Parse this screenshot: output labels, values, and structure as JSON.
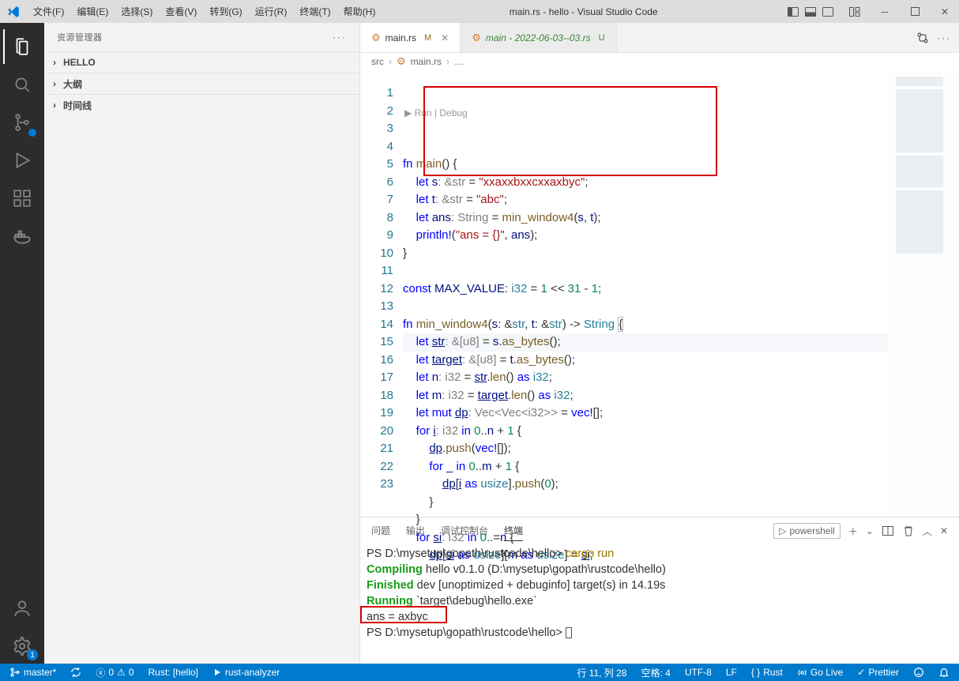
{
  "title": "main.rs - hello - Visual Studio Code",
  "menu": [
    "文件(F)",
    "编辑(E)",
    "选择(S)",
    "查看(V)",
    "转到(G)",
    "运行(R)",
    "终端(T)",
    "帮助(H)"
  ],
  "sidebar": {
    "header": "资源管理器",
    "sections": [
      {
        "label": "HELLO",
        "expanded": false
      },
      {
        "label": "大纲",
        "expanded": false
      },
      {
        "label": "时间线",
        "expanded": false
      }
    ]
  },
  "tabs": [
    {
      "icon": "rust",
      "label": "main.rs",
      "status": "M",
      "active": true,
      "closable": true
    },
    {
      "icon": "rust",
      "label": "main - 2022-06-03--03.rs",
      "status": "U",
      "active": false,
      "style": "italic"
    }
  ],
  "breadcrumb": {
    "parts": [
      "src",
      "main.rs",
      "…"
    ],
    "icon_after_src": "rust"
  },
  "codelens": "▶ Run | Debug",
  "code_lines": [
    {
      "n": 1,
      "html": "<span class='kw'>fn</span> <span class='fnname'>main</span>() {"
    },
    {
      "n": 2,
      "html": "    <span class='kw'>let</span> <span class='varsimple'>s</span><span class='fade'>: &str</span> = <span class='str'>\"xxaxxbxxcxxaxbyc\"</span>;"
    },
    {
      "n": 3,
      "html": "    <span class='kw'>let</span> <span class='varsimple'>t</span><span class='fade'>: &str</span> = <span class='str'>\"abc\"</span>;"
    },
    {
      "n": 4,
      "html": "    <span class='kw'>let</span> <span class='varsimple'>ans</span><span class='fade'>: String</span> = <span class='fnname'>min_window4</span>(<span class='varsimple'>s</span>, <span class='varsimple'>t</span>);"
    },
    {
      "n": 5,
      "html": "    <span class='macro'>println!</span>(<span class='str'>\"ans = {}\"</span>, <span class='varsimple'>ans</span>);"
    },
    {
      "n": 6,
      "html": "}"
    },
    {
      "n": 7,
      "html": ""
    },
    {
      "n": 8,
      "html": "<span class='kw'>const</span> <span class='varsimple'>MAX_VALUE</span>: <span class='ty'>i32</span> = <span class='num'>1</span> &lt;&lt; <span class='num'>31</span> - <span class='num'>1</span>;"
    },
    {
      "n": 9,
      "html": ""
    },
    {
      "n": 10,
      "html": "<span class='kw'>fn</span> <span class='fnname'>min_window4</span>(<span class='varsimple'>s</span>: &<span class='ty'>str</span>, <span class='varsimple'>t</span>: &<span class='ty'>str</span>) -&gt; <span class='ty'>String</span> <span class='brace-hi'>{</span>"
    },
    {
      "n": 11,
      "html": "    <span class='kw'>let</span> <span class='var'>str</span><span class='fade'>: &[u8]</span> = <span class='varsimple'>s</span>.<span class='fnname'>as_bytes</span>();",
      "hl": true
    },
    {
      "n": 12,
      "html": "    <span class='kw'>let</span> <span class='var'>target</span><span class='fade'>: &[u8]</span> = <span class='varsimple'>t</span>.<span class='fnname'>as_bytes</span>();"
    },
    {
      "n": 13,
      "html": "    <span class='kw'>let</span> <span class='varsimple'>n</span><span class='fade'>: i32</span> = <span class='var'>str</span>.<span class='fnname'>len</span>() <span class='kw'>as</span> <span class='ty'>i32</span>;"
    },
    {
      "n": 14,
      "html": "    <span class='kw'>let</span> <span class='varsimple'>m</span><span class='fade'>: i32</span> = <span class='var'>target</span>.<span class='fnname'>len</span>() <span class='kw'>as</span> <span class='ty'>i32</span>;"
    },
    {
      "n": 15,
      "html": "    <span class='kw'>let</span> <span class='kw'>mut</span> <span class='var'>dp</span><span class='fade'>: Vec&lt;Vec&lt;i32&gt;&gt;</span> = <span class='macro'>vec!</span>[];"
    },
    {
      "n": 16,
      "html": "    <span class='kw'>for</span> <span class='var'>i</span><span class='fade'>: i32</span> <span class='kw'>in</span> <span class='num'>0</span>..<span class='varsimple'>n</span> + <span class='num'>1</span> {"
    },
    {
      "n": 17,
      "html": "        <span class='var'>dp</span>.<span class='fnname'>push</span>(<span class='macro'>vec!</span>[]);"
    },
    {
      "n": 18,
      "html": "        <span class='kw'>for</span> <span class='varsimple'>_</span> <span class='kw'>in</span> <span class='num'>0</span>..<span class='varsimple'>m</span> + <span class='num'>1</span> {"
    },
    {
      "n": 19,
      "html": "            <span class='var'>dp</span>[<span class='var'>i</span> <span class='kw'>as</span> <span class='ty'>usize</span>].<span class='fnname'>push</span>(<span class='num'>0</span>);"
    },
    {
      "n": 20,
      "html": "        }"
    },
    {
      "n": 21,
      "html": "    }"
    },
    {
      "n": 22,
      "html": "    <span class='kw'>for</span> <span class='var'>si</span><span class='fade'>: i32</span> <span class='kw'>in</span> <span class='num'>0</span>..=<span class='varsimple'>n</span> {"
    },
    {
      "n": 23,
      "html": "        <span class='var'>dp</span>[<span class='var'>si</span> <span class='kw'>as</span> <span class='ty'>usize</span>][<span class='varsimple'>m</span> <span class='kw'>as</span> <span class='ty'>usize</span>] = <span class='var'>si</span>;"
    }
  ],
  "panel": {
    "tabs": [
      "问题",
      "输出",
      "调试控制台",
      "终端"
    ],
    "active_tab": 3,
    "shell_label": "powershell"
  },
  "terminal": {
    "lines": [
      {
        "t": "PS D:\\mysetup\\gopath\\rustcode\\hello> ",
        "cmd": "cargo run"
      },
      {
        "pre": "   Compiling",
        "rest": " hello v0.1.0 (D:\\mysetup\\gopath\\rustcode\\hello)",
        "cls": "grn"
      },
      {
        "pre": "    Finished",
        "rest": " dev [unoptimized + debuginfo] target(s) in 14.19s",
        "cls": "grn"
      },
      {
        "pre": "     Running",
        "rest": " `target\\debug\\hello.exe`",
        "cls": "grn"
      },
      {
        "plain": "ans = axbyc"
      },
      {
        "t": "PS D:\\mysetup\\gopath\\rustcode\\hello> ",
        "cursor": true
      }
    ]
  },
  "status": {
    "branch": "master*",
    "sync": "",
    "errors": "0",
    "warnings": "0",
    "rust_target": "Rust: [hello]",
    "rust_analyzer": "rust-analyzer",
    "ln_col": "行 11, 列 28",
    "spaces": "空格: 4",
    "encoding": "UTF-8",
    "eol": "LF",
    "lang": "Rust",
    "golive": "Go Live",
    "prettier": "Prettier"
  },
  "activity_badge": "1"
}
